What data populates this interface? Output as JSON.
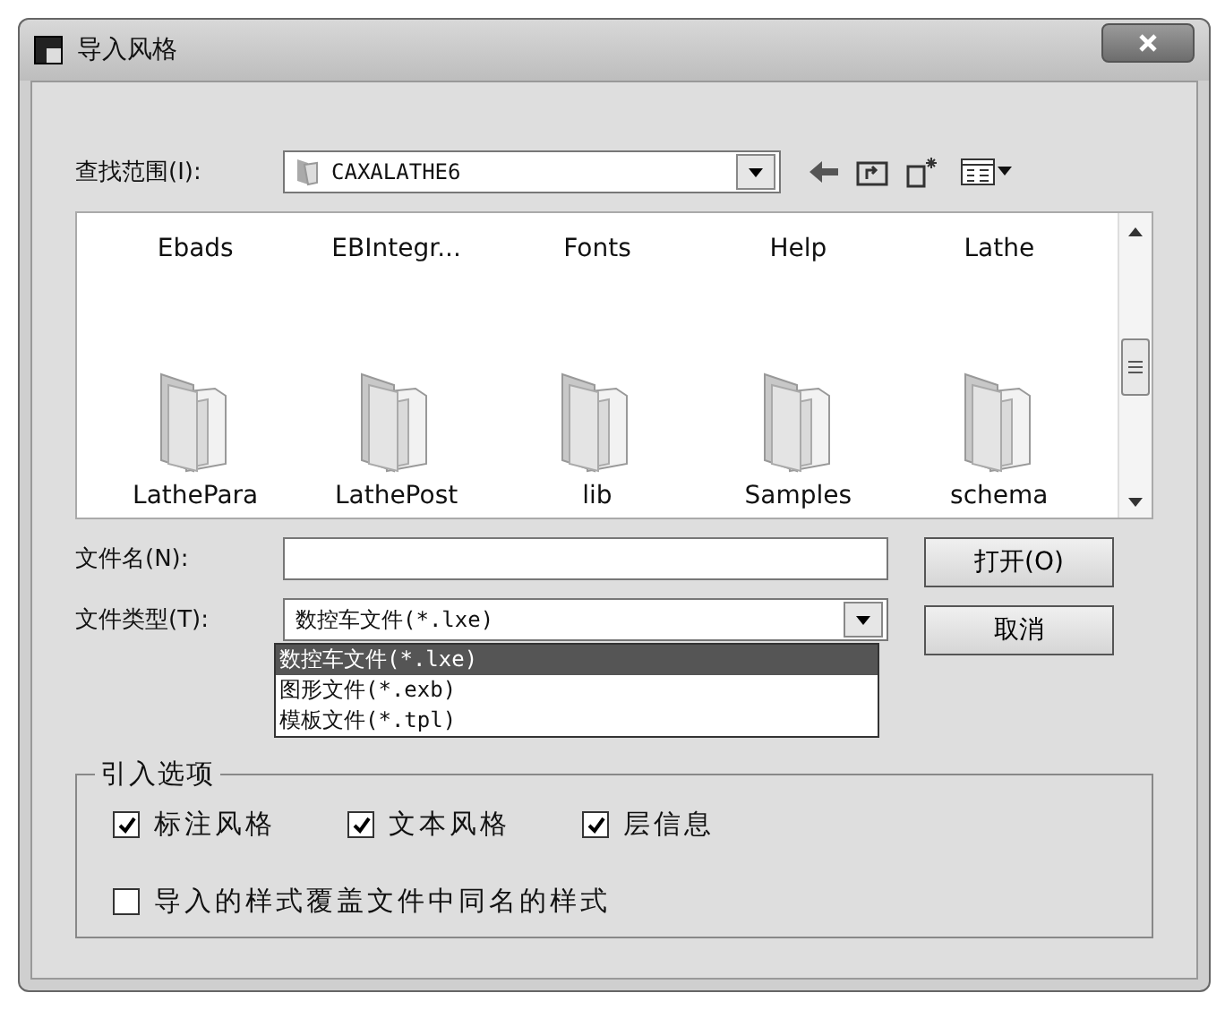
{
  "window": {
    "title": "导入风格"
  },
  "look_in": {
    "label": "查找范围(I):",
    "value": "CAXALATHE6"
  },
  "file_list": {
    "items": [
      {
        "name": "Ebads",
        "icon_visible": false
      },
      {
        "name": "EBIntegr...",
        "icon_visible": false
      },
      {
        "name": "Fonts",
        "icon_visible": false
      },
      {
        "name": "Help",
        "icon_visible": false
      },
      {
        "name": "Lathe",
        "icon_visible": false
      },
      {
        "name": "LathePara",
        "icon_visible": true
      },
      {
        "name": "LathePost",
        "icon_visible": true
      },
      {
        "name": "lib",
        "icon_visible": true
      },
      {
        "name": "Samples",
        "icon_visible": true
      },
      {
        "name": "schema",
        "icon_visible": true
      }
    ]
  },
  "file_name": {
    "label": "文件名(N):"
  },
  "file_type": {
    "label": "文件类型(T):",
    "value": "数控车文件(*.lxe)",
    "expanded": true,
    "options": [
      {
        "label": "数控车文件(*.lxe)",
        "selected": true
      },
      {
        "label": "图形文件(*.exb)",
        "selected": false
      },
      {
        "label": "模板文件(*.tpl)",
        "selected": false
      }
    ]
  },
  "buttons": [
    "打开(O)",
    "取消"
  ],
  "options_group": {
    "title": "引入选项",
    "checkboxes": [
      {
        "label": "标注风格",
        "checked": true
      },
      {
        "label": "文本风格",
        "checked": true
      },
      {
        "label": "层信息",
        "checked": true
      },
      {
        "label": "导入的样式覆盖文件中同名的样式",
        "checked": false
      }
    ]
  }
}
